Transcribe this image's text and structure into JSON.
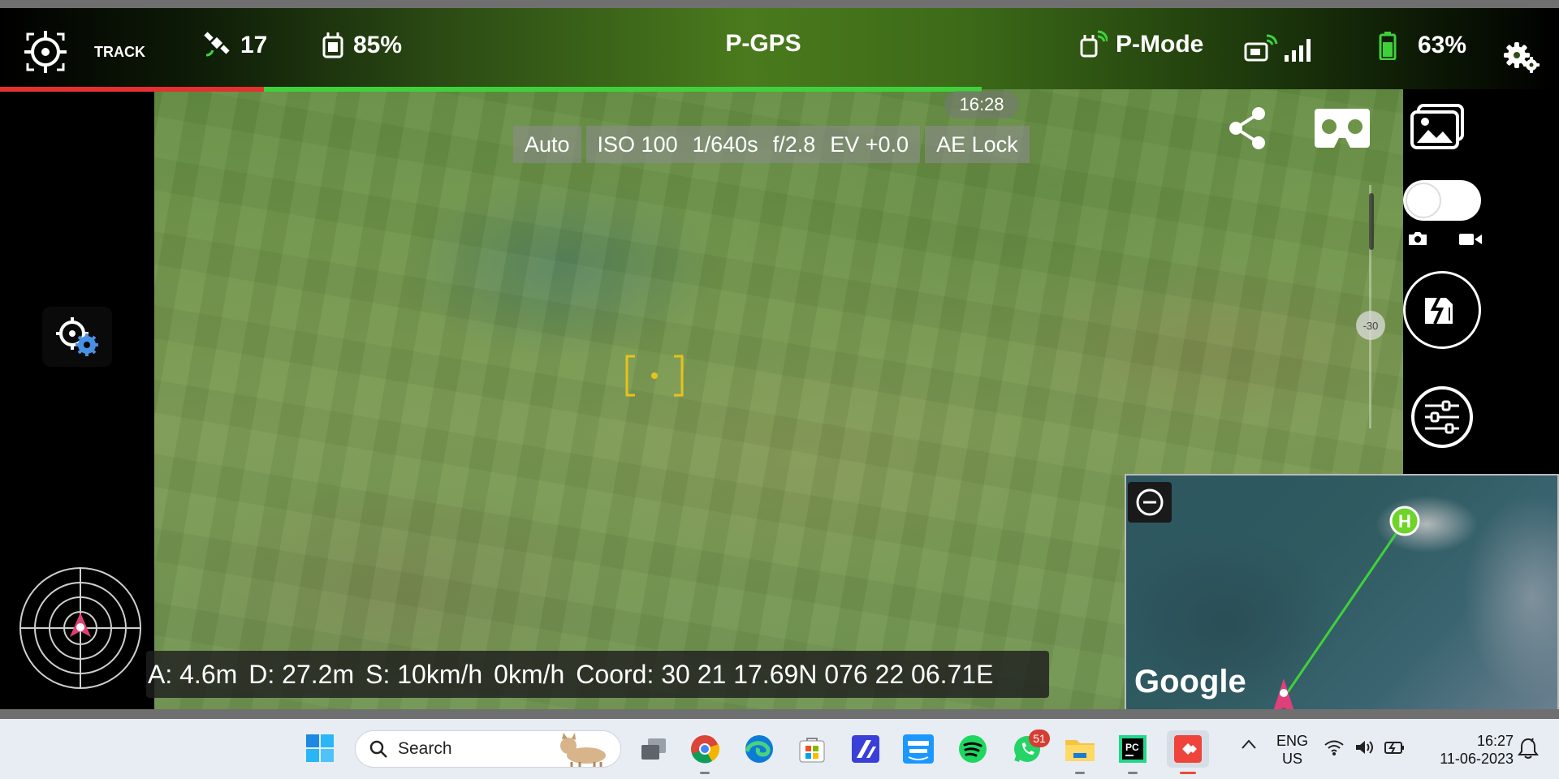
{
  "top_bar": {
    "track_label": "TRACK",
    "satellites": "17",
    "rc_battery": "85%",
    "gps_mode": "P-GPS",
    "flight_mode": "P-Mode",
    "drone_battery": "63%",
    "recording_progress_fraction": 0.63
  },
  "camera": {
    "timer": "16:28",
    "exposure_mode": "Auto",
    "iso": "ISO 100",
    "shutter": "1/640s",
    "aperture": "f/2.8",
    "ev": "EV +0.0",
    "ae_lock": "AE Lock",
    "gimbal_angle": "-30"
  },
  "telemetry": {
    "altitude": "A: 4.6m",
    "distance": "D: 27.2m",
    "speed": "S: 10km/h",
    "vertical_speed": "0km/h",
    "coord": "Coord: 30 21 17.69N 076 22 06.71E"
  },
  "map": {
    "google_label": "Google",
    "home_label": "H"
  },
  "taskbar": {
    "search_label": "Search",
    "whatsapp_badge": "51",
    "lang_line1": "ENG",
    "lang_line2": "US",
    "time": "16:27",
    "date": "11-06-2023"
  },
  "colors": {
    "progress_red": "#e53030",
    "progress_green": "#3fd13b",
    "reticle": "#e8c21a",
    "home_marker": "#6fd42a",
    "drone_marker": "#e0407a"
  }
}
